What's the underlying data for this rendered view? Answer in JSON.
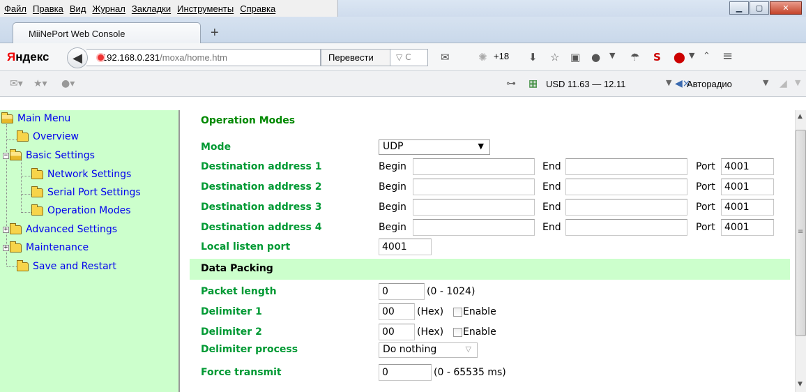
{
  "menubar": {
    "items": [
      "Файл",
      "Правка",
      "Вид",
      "Журнал",
      "Закладки",
      "Инструменты",
      "Справка"
    ]
  },
  "tab": {
    "title": "MiiNePort Web Console",
    "new_tab": "+"
  },
  "navbar": {
    "brand": "Яндекс",
    "url_host": "192.168.0.231",
    "url_path": "/moxa/home.htm",
    "translate_label": "Перевести",
    "weather": "+18"
  },
  "bookmarks": {
    "rate": "USD 11.63 — 12.11",
    "radio": "Авторадио"
  },
  "sidebar": {
    "items": [
      {
        "label": "Main Menu"
      },
      {
        "label": "Overview"
      },
      {
        "label": "Basic Settings"
      },
      {
        "label": "Network Settings"
      },
      {
        "label": "Serial Port Settings"
      },
      {
        "label": "Operation Modes"
      },
      {
        "label": "Advanced Settings"
      },
      {
        "label": "Maintenance"
      },
      {
        "label": "Save and Restart"
      }
    ]
  },
  "main": {
    "title": "Operation Modes",
    "mode": {
      "label": "Mode",
      "value": "UDP"
    },
    "begin_label": "Begin",
    "end_label": "End",
    "port_label": "Port",
    "destinations": [
      {
        "label": "Destination address 1",
        "begin": "",
        "end": "",
        "port": "4001"
      },
      {
        "label": "Destination address 2",
        "begin": "",
        "end": "",
        "port": "4001"
      },
      {
        "label": "Destination address 3",
        "begin": "",
        "end": "",
        "port": "4001"
      },
      {
        "label": "Destination address 4",
        "begin": "",
        "end": "",
        "port": "4001"
      }
    ],
    "local_port": {
      "label": "Local listen port",
      "value": "4001"
    },
    "data_packing": "Data Packing",
    "packet_length": {
      "label": "Packet length",
      "value": "0",
      "range": "(0 - 1024)"
    },
    "delimiter1": {
      "label": "Delimiter 1",
      "value": "00",
      "unit": "(Hex)",
      "enable": "Enable"
    },
    "delimiter2": {
      "label": "Delimiter 2",
      "value": "00",
      "unit": "(Hex)",
      "enable": "Enable"
    },
    "delimiter_process": {
      "label": "Delimiter process",
      "value": "Do nothing"
    },
    "force_transmit": {
      "label": "Force transmit",
      "value": "0",
      "range": "(0 - 65535 ms)"
    }
  }
}
